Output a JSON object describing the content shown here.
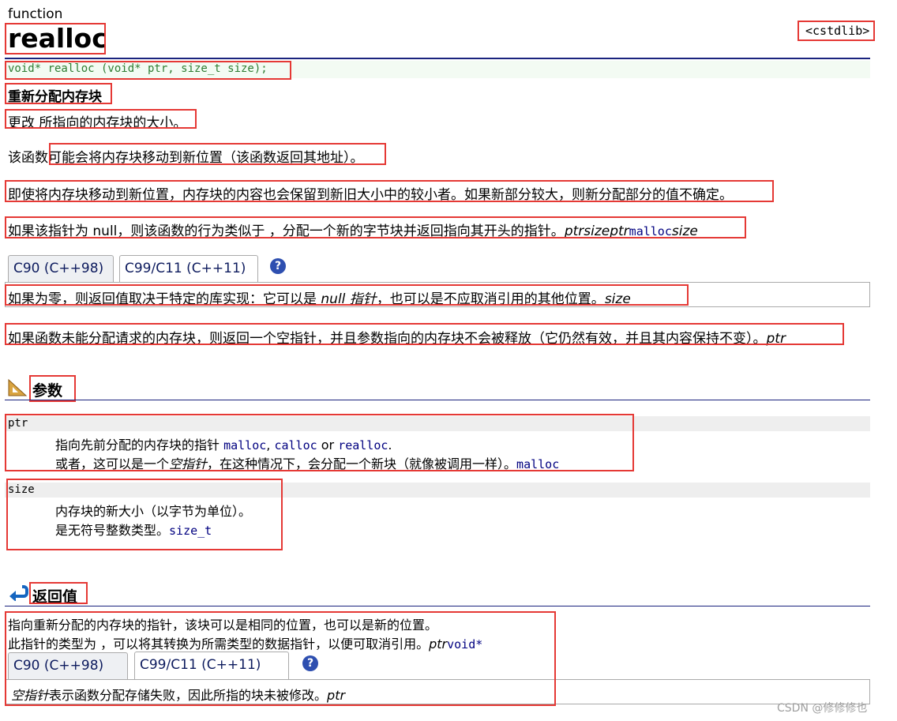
{
  "header": {
    "kind": "function",
    "name": "realloc",
    "header_file": "<cstdlib>",
    "prototype": "void* realloc (void* ptr, size_t size);"
  },
  "summary": {
    "title": "重新分配内存块",
    "desc": "更改 所指向的内存块的大小。"
  },
  "paragraphs": {
    "p1_pre": "该函数",
    "p1_main": "可能会将内存块移动到新位置（该函数返回其地址）。",
    "p2": "即使将内存块移动到新位置，内存块的内容也会保留到新旧大小中的较小者。如果新部分较大，则新分配部分的值不确定。",
    "p3_text": "如果该指针为 null，则该函数的行为类似于 ，分配一个新的字节块并返回指向其开头的指针。",
    "p3_ital1": "ptrsizeptr",
    "p3_code": "malloc",
    "p3_ital2": "size",
    "p4_text": "如果为零，则返回值取决于特定的库实现：它可以是 ",
    "p4_ital": "null 指针",
    "p4_text2": "，也可以是不应取消引用的其他位置。",
    "p4_ital2": "size",
    "p5_text": "如果函数未能分配请求的内存块，则返回一个空指针，并且参数指向的内存块不会被释放（它仍然有效，并且其内容保持不变）。",
    "p5_ital": "ptr"
  },
  "tabs1": {
    "tab1": "C90 (C++98)",
    "tab2": "C99/C11 (C++11)",
    "help": "?"
  },
  "params": {
    "title": "参数",
    "ptr_name": "ptr",
    "ptr_line1": "指向先前分配的内存块的指针 ",
    "ptr_code1": "malloc",
    "ptr_sep1": ", ",
    "ptr_code2": "calloc",
    "ptr_or": " or ",
    "ptr_code3": "realloc",
    "ptr_dot": ".",
    "ptr_line2_a": "或者，这可以是一个",
    "ptr_line2_ital": "空指针",
    "ptr_line2_b": "，在这种情况下，会分配一个新块（就像被调用一样）。",
    "ptr_line2_code": "malloc",
    "size_name": "size",
    "size_line1": "内存块的新大小（以字节为单位）。",
    "size_line2": "是无符号整数类型。",
    "size_line2_code": "size_t"
  },
  "retval": {
    "title": "返回值",
    "line1": "指向重新分配的内存块的指针，该块可以是相同的位置，也可以是新的位置。",
    "line2": "此指针的类型为 ，可以将其转换为所需类型的数据指针，以便可取消引用。",
    "line2_ital": "ptr",
    "line2_code": "void*",
    "tab1": "C90  (C++98)",
    "tab2": "C99/C11  (C++11)",
    "help": "?",
    "box_ital": "空指针",
    "box_text": "表示函数分配存储失败，因此所指的块未被修改。",
    "box_ital2": "ptr"
  },
  "watermark": "CSDN @修修修也",
  "colors": {
    "highlight": "#e53935",
    "link": "#000080",
    "rule": "#1a237e"
  }
}
